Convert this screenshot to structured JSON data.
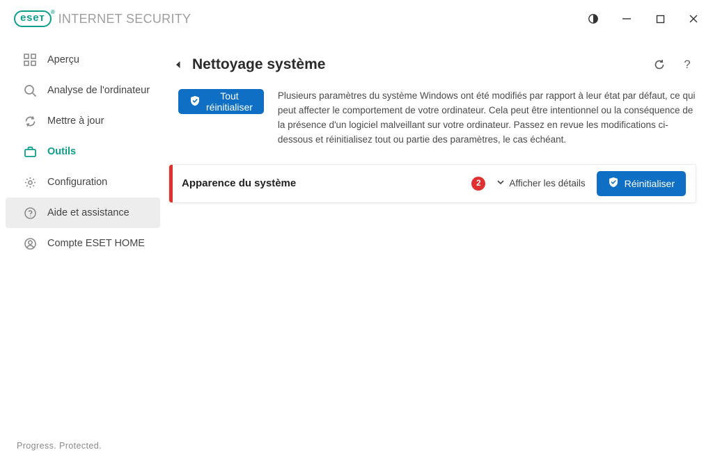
{
  "app": {
    "product": "INTERNET SECURITY",
    "logo_text": "eseт"
  },
  "sidebar": {
    "items": [
      {
        "label": "Aperçu"
      },
      {
        "label": "Analyse de l'ordinateur"
      },
      {
        "label": "Mettre à jour"
      },
      {
        "label": "Outils"
      },
      {
        "label": "Configuration"
      },
      {
        "label": "Aide et assistance"
      },
      {
        "label": "Compte ESET HOME"
      }
    ]
  },
  "footer": {
    "tagline": "Progress. Protected."
  },
  "page": {
    "title": "Nettoyage système",
    "reset_all_label": "Tout réinitialiser",
    "description": "Plusieurs paramètres du système Windows ont été modifiés par rapport à leur état par défaut, ce qui peut affecter le comportement de votre ordinateur. Cela peut être intentionnel ou la conséquence de la présence d'un logiciel malveillant sur votre ordinateur. Passez en revue les modifications ci-dessous et réinitialisez tout ou partie des paramètres, le cas échéant."
  },
  "card": {
    "title": "Apparence du système",
    "count": "2",
    "details_label": "Afficher les détails",
    "reset_label": "Réinitialiser"
  }
}
